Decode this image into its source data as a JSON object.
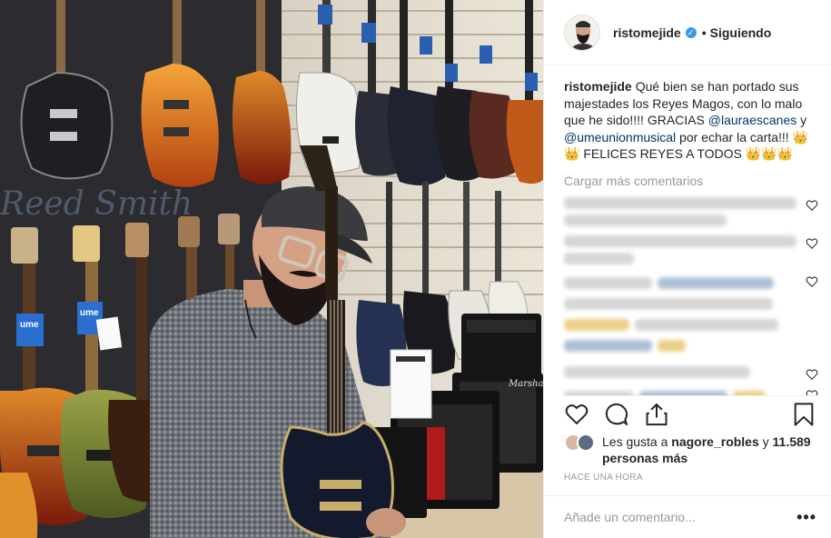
{
  "post": {
    "username": "ristomejide",
    "follow_label": "Siguiendo",
    "caption_user": "ristomejide",
    "caption_text_1": "Qué bien se han portado sus majestades los Reyes Magos, con lo malo que he sido!!!! GRACIAS ",
    "mention_1": "@lauraescanes",
    "caption_text_2": " y ",
    "mention_2": "@umeunionmusical",
    "caption_text_3": " por echar la carta!!! 👑👑 FELICES REYES A TODOS 👑👑👑",
    "load_more": "Cargar más comentarios",
    "likes_prefix": "Les gusta a ",
    "likes_user": "nagore_robles",
    "likes_mid": " y ",
    "likes_count": "11.589 personas más",
    "timestamp": "HACE UNA HORA",
    "comment_placeholder": "Añade un comentario...",
    "more_label": "•••"
  },
  "photo": {
    "brand_sign": "ume",
    "wall_text": "Reed Smith"
  },
  "colors": {
    "link": "#003569",
    "verified": "#3897f0",
    "muted": "#999999"
  },
  "icons": [
    "heart-icon",
    "comment-icon",
    "share-icon",
    "bookmark-icon",
    "verified-icon",
    "more-icon"
  ]
}
